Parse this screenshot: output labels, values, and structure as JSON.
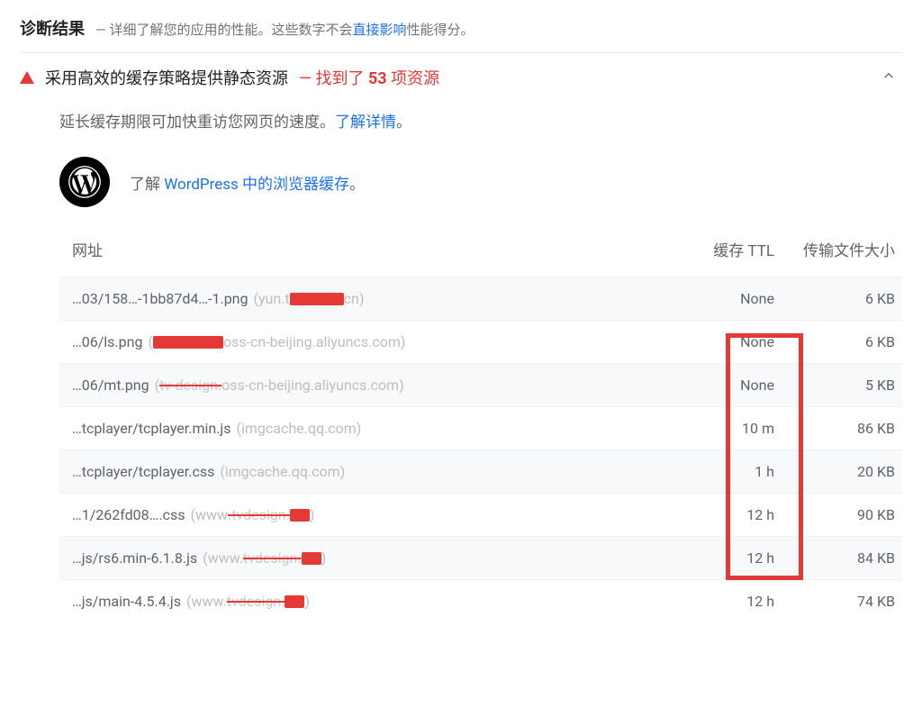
{
  "header": {
    "title": "诊断结果",
    "dash": "—",
    "desc_pre": "详细了解您的应用的性能。这些数字不会",
    "desc_link": "直接影响",
    "desc_post": "性能得分。"
  },
  "audit": {
    "title": "采用高效的缓存策略提供静态资源",
    "count_prefix": "— 找到了 ",
    "count_num": "53",
    "count_suffix": " 项资源",
    "tip_pre": "延长缓存期限可加快重访您网页的速度。",
    "tip_link": "了解详情",
    "tip_post": "。",
    "wp_pre": "了解 ",
    "wp_link": "WordPress 中的浏览器缓存",
    "wp_post": "。"
  },
  "table": {
    "col_url": "网址",
    "col_ttl": "缓存 TTL",
    "col_size": "传输文件大小",
    "rows": [
      {
        "path": "…03/158…-1bb87d4…-1.png",
        "host_pre": "(yun.t",
        "host_mid_redact_w": 60,
        "host_post": "cn)",
        "ttl": "None",
        "size": "6 KB"
      },
      {
        "path": "…06/ls.png",
        "host_pre": "(",
        "host_mid_redact_w": 78,
        "host_post": "oss-cn-beijing.aliyuncs.com)",
        "ttl": "None",
        "size": "6 KB"
      },
      {
        "path": "…06/mt.png",
        "host_pre": "(",
        "host_mid_strike": "tv-design.",
        "host_post": "oss-cn-beijing.aliyuncs.com)",
        "ttl": "None",
        "size": "5 KB"
      },
      {
        "path": "…tcplayer/tcplayer.min.js",
        "host_plain": "(imgcache.qq.com)",
        "ttl": "10 m",
        "size": "86 KB"
      },
      {
        "path": "…tcplayer/tcplayer.css",
        "host_plain": "(imgcache.qq.com)",
        "ttl": "1 h",
        "size": "20 KB"
      },
      {
        "path": "…1/262fd08….css",
        "host_pre": "(www",
        "host_mid_strike": ".tvdesign.",
        "host_mid_redact_w": 22,
        "host_post": ")",
        "ttl": "12 h",
        "size": "90 KB"
      },
      {
        "path": "…js/rs6.min-6.1.8.js",
        "host_pre": "(www.",
        "host_mid_strike": "tvdesign.",
        "host_mid_redact_w": 22,
        "host_post": ")",
        "ttl": "12 h",
        "size": "84 KB"
      },
      {
        "path": "…js/main-4.5.4.js",
        "host_pre": "(www.",
        "host_mid_strike": "tvdesign.",
        "host_mid_redact_w": 22,
        "host_post": ")",
        "ttl": "12 h",
        "size": "74 KB"
      }
    ]
  }
}
